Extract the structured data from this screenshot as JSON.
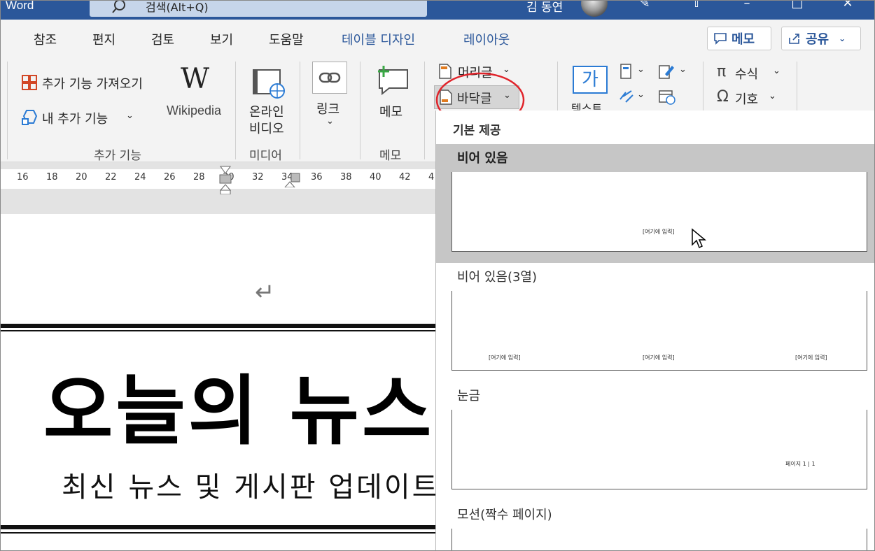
{
  "titlebar": {
    "app_name": "Word",
    "search_placeholder": "검색(Alt+Q)",
    "user_name": "김 동연"
  },
  "tabs": [
    {
      "label": "참조"
    },
    {
      "label": "편지"
    },
    {
      "label": "검토"
    },
    {
      "label": "보기"
    },
    {
      "label": "도움말"
    },
    {
      "label": "테이블 디자인"
    },
    {
      "label": "레이아웃"
    }
  ],
  "top_buttons": {
    "memo": "메모",
    "share": "공유"
  },
  "ribbon": {
    "addins": {
      "get_addins": "추가 기능 가져오기",
      "my_addins": "내 추가 기능",
      "wikipedia": "Wikipedia",
      "group_label": "추가 기능"
    },
    "media": {
      "online_video_line1": "온라인",
      "online_video_line2": "비디오",
      "group_label": "미디어"
    },
    "links": {
      "link": "링크"
    },
    "comments": {
      "memo": "메모",
      "group_label": "메모"
    },
    "header_footer": {
      "header": "머리글",
      "footer": "바닥글"
    },
    "text": {
      "text_box": "가",
      "text_label": "텍스트"
    },
    "symbols": {
      "equation": "수식",
      "symbol": "기호"
    }
  },
  "ruler": {
    "numbers": [
      "16",
      "18",
      "20",
      "22",
      "24",
      "26",
      "28",
      "30",
      "32",
      "34",
      "36",
      "38",
      "40",
      "42",
      "4"
    ]
  },
  "document": {
    "paragraph_mark": "↵",
    "title": "오늘의 뉴스",
    "subtitle": "최신 뉴스 및 게시판 업데이트"
  },
  "gallery": {
    "header": "기본 제공",
    "items": [
      {
        "name": "비어 있음",
        "placeholders": [
          "[여기에 입력]"
        ],
        "highlighted": true
      },
      {
        "name": "비어 있음(3열)",
        "placeholders": [
          "[여기에 입력]",
          "[여기에 입력]",
          "[여기에 입력]"
        ]
      },
      {
        "name": "눈금",
        "placeholders": [
          "페이지 1 | 1"
        ]
      },
      {
        "name": "모션(짝수 페이지)",
        "placeholders": []
      }
    ]
  },
  "colors": {
    "word_blue": "#2b579a",
    "annotation_red": "#e0242b",
    "highlight_gray": "#c6c6c6"
  }
}
